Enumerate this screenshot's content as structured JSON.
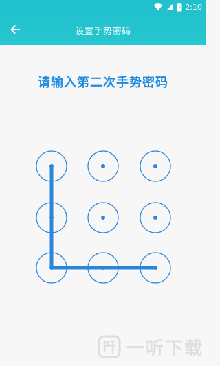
{
  "status_bar": {
    "time": "2:10",
    "icons": [
      "wifi-icon",
      "signal-icon",
      "battery-icon"
    ]
  },
  "app_bar": {
    "title": "设置手势密码",
    "back_icon": "arrow-left-icon"
  },
  "prompt": "请输入第二次手势密码",
  "pattern": {
    "rows": 3,
    "cols": 3,
    "selected_path": [
      0,
      3,
      6,
      7,
      8
    ]
  },
  "watermark": {
    "logo_icon": "ting-logo-icon",
    "text": "一听下载"
  },
  "colors": {
    "accent": "#21c1cd",
    "pattern_blue": "#2b86db"
  }
}
